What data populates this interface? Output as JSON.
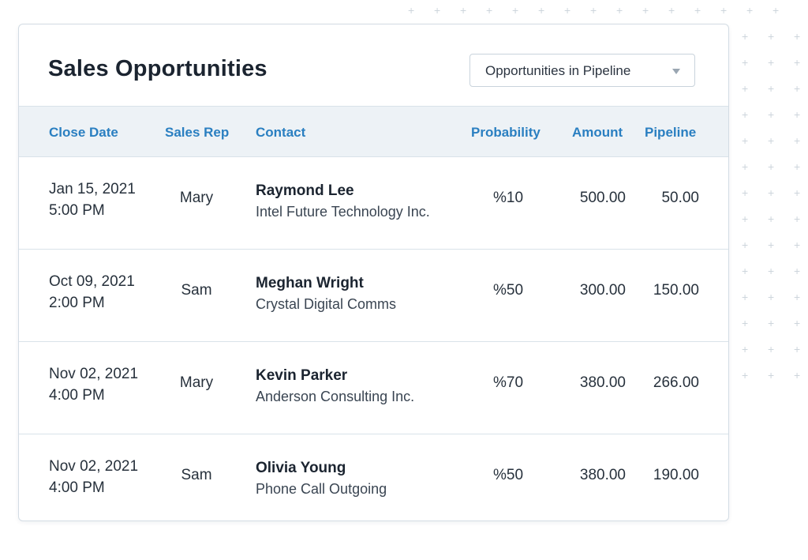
{
  "card": {
    "title": "Sales Opportunities",
    "filter_select": {
      "value": "Opportunities in Pipeline"
    }
  },
  "table": {
    "headers": {
      "close_date": "Close Date",
      "sales_rep": "Sales Rep",
      "contact": "Contact",
      "probability": "Probability",
      "amount": "Amount",
      "pipeline": "Pipeline"
    },
    "rows": [
      {
        "date": "Jan 15, 2021",
        "time": "5:00 PM",
        "rep": "Mary",
        "contact_name": "Raymond Lee",
        "company": "Intel Future Technology Inc.",
        "probability": "%10",
        "amount": "500.00",
        "pipeline": "50.00"
      },
      {
        "date": "Oct 09, 2021",
        "time": "2:00 PM",
        "rep": "Sam",
        "contact_name": "Meghan Wright",
        "company": "Crystal Digital Comms",
        "probability": "%50",
        "amount": "300.00",
        "pipeline": "150.00"
      },
      {
        "date": "Nov 02, 2021",
        "time": "4:00 PM",
        "rep": "Mary",
        "contact_name": "Kevin Parker",
        "company": "Anderson Consulting Inc.",
        "probability": "%70",
        "amount": "380.00",
        "pipeline": "266.00"
      },
      {
        "date": "Nov 02, 2021",
        "time": "4:00 PM",
        "rep": "Sam",
        "contact_name": "Olivia Young",
        "company": "Phone Call Outgoing",
        "probability": "%50",
        "amount": "380.00",
        "pipeline": "190.00"
      }
    ]
  },
  "colors": {
    "accent": "#2a7fc1",
    "header_bg": "#edf2f6",
    "text": "#1b2430",
    "decor_plus": "#cdd5dc"
  },
  "icons": {
    "select_caret": "caret-down-icon",
    "background_pattern": "plus-icon"
  }
}
